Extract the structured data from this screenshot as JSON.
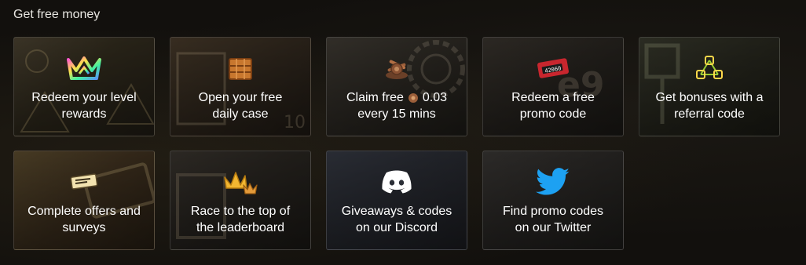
{
  "section": {
    "title": "Get free money"
  },
  "cards": [
    {
      "name": "level-rewards",
      "icon": "crown-rainbow-icon",
      "line1": "Redeem your level",
      "line2": "rewards"
    },
    {
      "name": "daily-case",
      "icon": "wooden-crate-icon",
      "line1": "Open your free",
      "line2": "daily case"
    },
    {
      "name": "claim-free",
      "icon": "coin-pile-icon",
      "line1_prefix": "Claim free",
      "line1_suffix": "0.03",
      "line2": "every 15 mins",
      "inline_icon": "coin-icon"
    },
    {
      "name": "promo-code",
      "icon": "promo-ticket-icon",
      "line1": "Redeem a free",
      "line2": "promo code",
      "ticket_text": "42060"
    },
    {
      "name": "referral-code",
      "icon": "referral-network-icon",
      "line1": "Get bonuses with a",
      "line2": "referral code"
    },
    {
      "name": "offers-surveys",
      "icon": "voucher-ticket-icon",
      "line1": "Complete offers and",
      "line2": "surveys"
    },
    {
      "name": "leaderboard",
      "icon": "gold-crown-icon",
      "line1": "Race to the top of",
      "line2": "the leaderboard"
    },
    {
      "name": "discord",
      "icon": "discord-icon",
      "line1": "Giveaways & codes",
      "line2": "on our Discord"
    },
    {
      "name": "twitter",
      "icon": "twitter-bird-icon",
      "line1": "Find promo codes",
      "line2": "on our Twitter"
    }
  ],
  "colors": {
    "background": "#12100d",
    "text": "#ffffff",
    "discord": "#ffffff",
    "twitter": "#1da1f2",
    "gold": "#f2b631",
    "promo_red": "#c8262e"
  }
}
